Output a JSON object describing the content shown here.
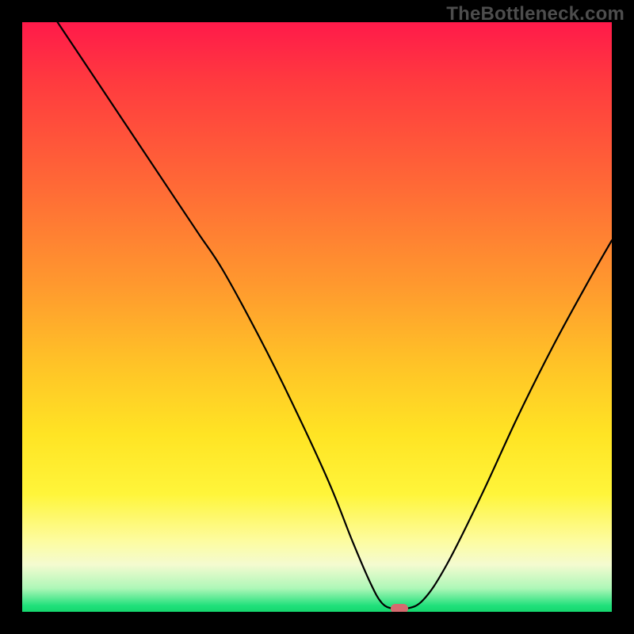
{
  "watermark": "TheBottleneck.com",
  "chart_data": {
    "type": "line",
    "title": "",
    "xlabel": "",
    "ylabel": "",
    "xlim": [
      0,
      100
    ],
    "ylim": [
      0,
      100
    ],
    "grid": false,
    "legend": false,
    "series": [
      {
        "name": "bottleneck-curve",
        "x": [
          6,
          10,
          18,
          26,
          30,
          34,
          40,
          46,
          52,
          56,
          59,
          61,
          63,
          65,
          68,
          72,
          78,
          84,
          90,
          96,
          100
        ],
        "y": [
          100,
          94,
          82,
          70,
          64,
          58,
          47,
          35,
          22,
          12,
          5,
          1.5,
          0.5,
          0.5,
          2,
          8,
          20,
          33,
          45,
          56,
          63
        ]
      }
    ],
    "marker": {
      "x": 64,
      "y": 0.5,
      "shape": "pill",
      "color": "#d66a6f"
    },
    "background_gradient": {
      "direction": "vertical",
      "stops": [
        {
          "pos": 0,
          "color": "#ff1a4a"
        },
        {
          "pos": 45,
          "color": "#ff9a2e"
        },
        {
          "pos": 70,
          "color": "#ffe424"
        },
        {
          "pos": 92,
          "color": "#f4fbd0"
        },
        {
          "pos": 100,
          "color": "#16d76e"
        }
      ]
    }
  }
}
